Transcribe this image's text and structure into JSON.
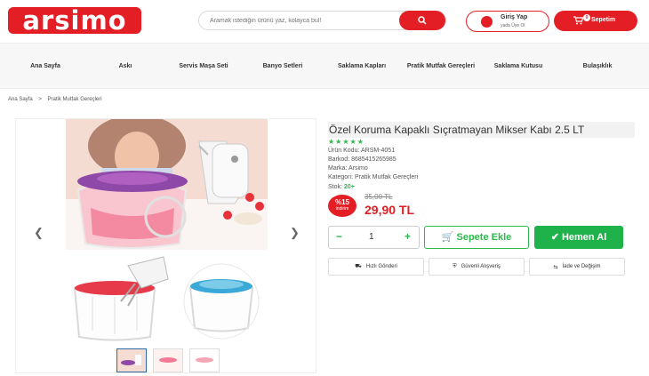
{
  "header": {
    "logo_text": "arsimo",
    "search_placeholder": "Aramak istediğin ürünü yaz, kolayca bul!",
    "login_title": "Giriş Yap",
    "login_subtitle": "yada Üye Ol",
    "cart_label": "Sepetim",
    "cart_count": "0"
  },
  "nav": {
    "items": [
      {
        "label": "Ana Sayfa"
      },
      {
        "label": "Askı"
      },
      {
        "label": "Servis Maşa Seti"
      },
      {
        "label": "Banyo Setleri"
      },
      {
        "label": "Saklama Kapları"
      },
      {
        "label": "Pratik Mutfak Gereçleri"
      },
      {
        "label": "Saklama Kutusu"
      },
      {
        "label": "Bulaşıklık"
      }
    ]
  },
  "breadcrumb": {
    "home": "Ana Sayfa",
    "separator": ">",
    "current": "Pratik Mutfak Gereçleri"
  },
  "product": {
    "title": "Özel Koruma Kapaklı Sıçratmayan Mikser Kabı 2.5 LT",
    "rating": "★★★★★",
    "code": "Ürün Kodu: ARSM-4051",
    "barcode": "Barkod: 8685415265985",
    "brand": "Marka: Arsimo",
    "category": "Kategori: Pratik Mutfak Gereçleri",
    "stock_label": "Stok:",
    "stock_value": "20+",
    "discount_pct": "%15",
    "discount_label": "indirim",
    "old_price": "35,00 TL",
    "new_price": "29,90 TL",
    "quantity": "1",
    "add_to_cart": "Sepete Ekle",
    "buy_now": "Hemen Al"
  },
  "features": [
    {
      "label": "Hızlı Gönderi"
    },
    {
      "label": "Güvenli Alışveriş"
    },
    {
      "label": "İade ve Değişim"
    }
  ],
  "colors": {
    "brand_red": "#e31e24",
    "accent_green": "#2db84c"
  }
}
